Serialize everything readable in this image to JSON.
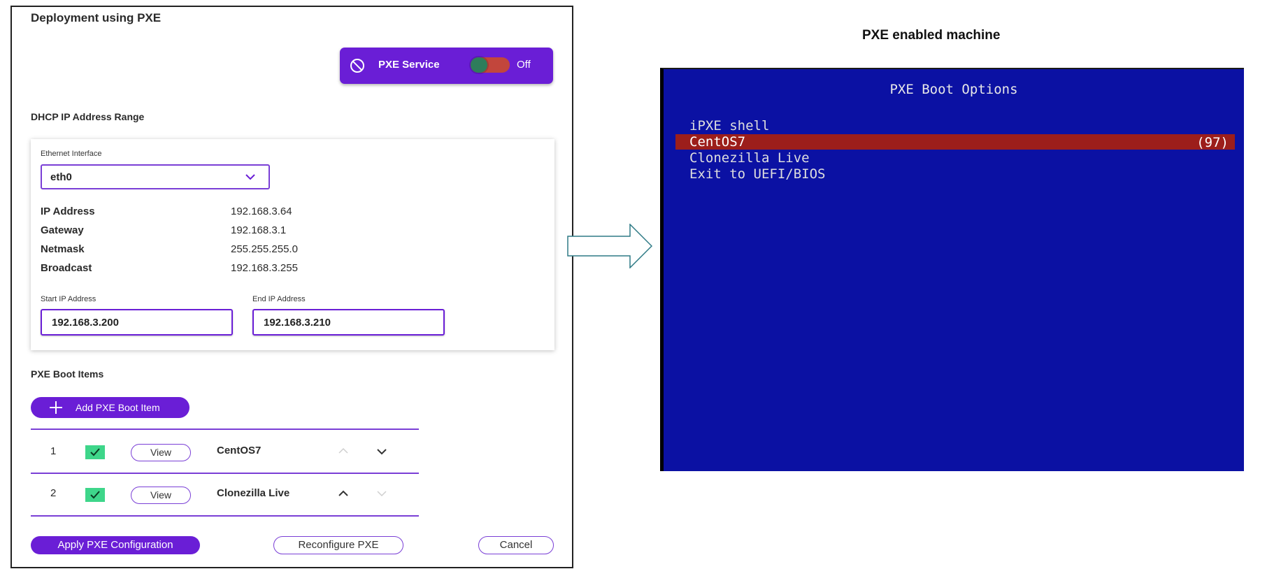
{
  "left_panel": {
    "title": "Deployment using PXE",
    "pxe_service": {
      "label": "PXE Service",
      "toggle_state": "Off",
      "icon": "ban-icon"
    },
    "dhcp": {
      "section_title": "DHCP IP Address Range",
      "ethernet_label": "Ethernet Interface",
      "ethernet_value": "eth0",
      "info": [
        {
          "key": "IP Address",
          "value": "192.168.3.64"
        },
        {
          "key": "Gateway",
          "value": "192.168.3.1"
        },
        {
          "key": "Netmask",
          "value": "255.255.255.0"
        },
        {
          "key": "Broadcast",
          "value": "192.168.3.255"
        }
      ],
      "start_ip_label": "Start IP Address",
      "start_ip_value": "192.168.3.200",
      "end_ip_label": "End IP Address",
      "end_ip_value": "192.168.3.210"
    },
    "boot_items": {
      "section_title": "PXE Boot Items",
      "add_button": "Add PXE Boot Item",
      "rows": [
        {
          "index": "1",
          "checked": true,
          "view_label": "View",
          "name": "CentOS7"
        },
        {
          "index": "2",
          "checked": true,
          "view_label": "View",
          "name": "Clonezilla Live"
        }
      ]
    },
    "buttons": {
      "apply": "Apply PXE Configuration",
      "reconfigure": "Reconfigure PXE",
      "cancel": "Cancel"
    }
  },
  "right_panel": {
    "caption": "PXE enabled machine",
    "bios": {
      "title": "PXE Boot Options",
      "items": [
        "iPXE shell",
        "CentOS7",
        "Clonezilla Live",
        "Exit to UEFI/BIOS"
      ],
      "selected_index": 1,
      "countdown": "(97)"
    }
  },
  "colors": {
    "accent": "#6a1ed6",
    "check": "#3ed68a",
    "bios_bg": "#0b11a3",
    "bios_selected": "#9c1e1b"
  }
}
